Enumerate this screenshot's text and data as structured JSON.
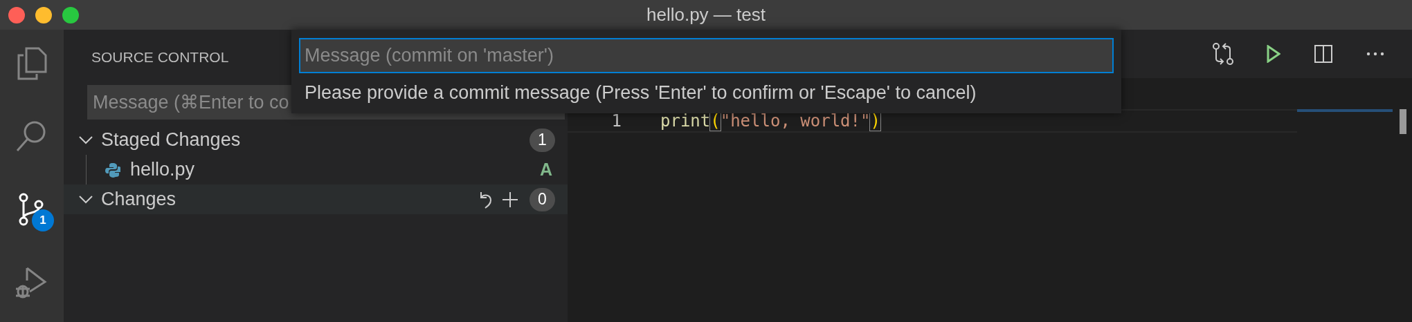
{
  "window": {
    "title": "hello.py — test"
  },
  "activity_bar": [
    {
      "kind": "files",
      "selected": false
    },
    {
      "kind": "search",
      "selected": false
    },
    {
      "kind": "source-control",
      "selected": true,
      "badge": "1"
    },
    {
      "kind": "run",
      "selected": false
    }
  ],
  "sidebar": {
    "title": "SOURCE CONTROL",
    "message_input": {
      "placeholder": "Message (⌘Enter to co"
    },
    "groups": [
      {
        "label": "Staged Changes",
        "count": "1",
        "expanded": true,
        "selected": false,
        "files": [
          {
            "name": "hello.py",
            "status": "A"
          }
        ]
      },
      {
        "label": "Changes",
        "count": "0",
        "expanded": true,
        "selected": true
      }
    ]
  },
  "quick_input": {
    "placeholder": "Message (commit on 'master')",
    "message": "Please provide a commit message (Press 'Enter' to confirm or 'Escape' to cancel)"
  },
  "editor": {
    "lines": [
      {
        "number": "1",
        "tokens": [
          {
            "kind": "function",
            "text": "print"
          },
          {
            "kind": "bracket",
            "text": "("
          },
          {
            "kind": "string",
            "text": "\"hello, world!\""
          },
          {
            "kind": "bracket",
            "text": ")"
          }
        ]
      }
    ]
  }
}
